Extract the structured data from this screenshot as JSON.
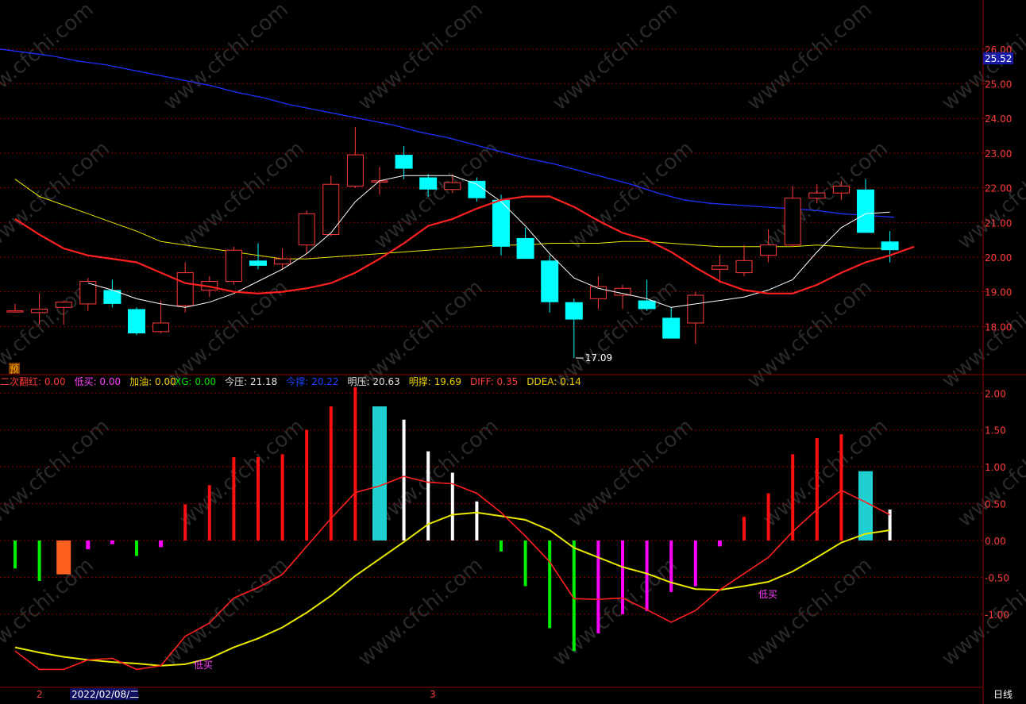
{
  "colors": {
    "background": "#000000",
    "grid": "#8B0000",
    "up": "#FF3A3A",
    "down": "#00FFFF",
    "axis_text": "#FF3A3A",
    "ma_white": "#FFFFFF",
    "ma_yellow": "#E8E800",
    "ma_red": "#FF2020",
    "ma_blue": "#2030FF",
    "macd_pos": "#FF1010",
    "macd_neg": "#00EE00",
    "magenta": "#FF00FF",
    "cyan_bar": "#20D0D0",
    "orange_bar": "#FF6020",
    "white_bar": "#FFFFFF"
  },
  "ui": {
    "price_tag": "25.52",
    "low_annotation": "17.09",
    "yu_badge": "预",
    "date_label": "2022/02/08/二",
    "marker_2": "2",
    "marker_3": "3",
    "period": "日线",
    "buy_label_1": "低买",
    "buy_label_2": "低买"
  },
  "indicator_legend": [
    {
      "label": "二次翻红:",
      "value": "0.00",
      "color": "#FF3A3A"
    },
    {
      "label": "低买:",
      "value": "0.00",
      "color": "#FF40FF"
    },
    {
      "label": "加油:",
      "value": "0.00",
      "color": "#F0D000"
    },
    {
      "label": "XG:",
      "value": "0.00",
      "color": "#00E000"
    },
    {
      "label": "今压:",
      "value": "21.18",
      "color": "#E0E0E0"
    },
    {
      "label": "今撑:",
      "value": "20.22",
      "color": "#2040FF"
    },
    {
      "label": "明压:",
      "value": "20.63",
      "color": "#E0E0E0"
    },
    {
      "label": "明撑:",
      "value": "19.69",
      "color": "#F0D000"
    },
    {
      "label": "DIFF:",
      "value": "0.35",
      "color": "#FF3A3A"
    },
    {
      "label": "DDEA:",
      "value": "0.14",
      "color": "#F0D000"
    }
  ],
  "chart_data": [
    {
      "type": "candlestick",
      "ylim": [
        17.0,
        26.5
      ],
      "yticks": [
        "18.00",
        "19.00",
        "20.00",
        "21.00",
        "22.00",
        "23.00",
        "24.00",
        "25.00",
        "26.00"
      ],
      "candles": [
        {
          "o": 18.45,
          "h": 18.65,
          "l": 18.4,
          "c": 18.45
        },
        {
          "o": 18.4,
          "h": 18.95,
          "l": 18.05,
          "c": 18.5
        },
        {
          "o": 18.55,
          "h": 18.75,
          "l": 18.05,
          "c": 18.7
        },
        {
          "o": 18.65,
          "h": 19.4,
          "l": 18.45,
          "c": 19.3
        },
        {
          "o": 19.05,
          "h": 19.35,
          "l": 18.55,
          "c": 18.65
        },
        {
          "o": 18.5,
          "h": 18.55,
          "l": 17.75,
          "c": 17.8
        },
        {
          "o": 17.85,
          "h": 18.75,
          "l": 17.8,
          "c": 18.1
        },
        {
          "o": 18.6,
          "h": 19.85,
          "l": 18.4,
          "c": 19.55
        },
        {
          "o": 19.05,
          "h": 19.45,
          "l": 18.85,
          "c": 19.3
        },
        {
          "o": 19.3,
          "h": 20.3,
          "l": 19.2,
          "c": 20.2
        },
        {
          "o": 19.9,
          "h": 20.4,
          "l": 19.65,
          "c": 19.75
        },
        {
          "o": 19.8,
          "h": 20.25,
          "l": 19.65,
          "c": 19.95
        },
        {
          "o": 20.35,
          "h": 21.35,
          "l": 20.1,
          "c": 21.25
        },
        {
          "o": 20.65,
          "h": 22.35,
          "l": 20.6,
          "c": 22.1
        },
        {
          "o": 22.05,
          "h": 23.75,
          "l": 22.0,
          "c": 22.95
        },
        {
          "o": 22.2,
          "h": 22.6,
          "l": 21.8,
          "c": 22.2
        },
        {
          "o": 22.95,
          "h": 23.2,
          "l": 22.25,
          "c": 22.55
        },
        {
          "o": 22.3,
          "h": 22.4,
          "l": 21.75,
          "c": 21.95
        },
        {
          "o": 21.95,
          "h": 22.4,
          "l": 21.85,
          "c": 22.15
        },
        {
          "o": 22.2,
          "h": 22.3,
          "l": 21.6,
          "c": 21.7
        },
        {
          "o": 21.65,
          "h": 21.8,
          "l": 20.05,
          "c": 20.3
        },
        {
          "o": 20.55,
          "h": 20.85,
          "l": 20.0,
          "c": 19.95
        },
        {
          "o": 19.9,
          "h": 20.05,
          "l": 18.4,
          "c": 18.7
        },
        {
          "o": 18.7,
          "h": 18.8,
          "l": 17.09,
          "c": 18.2
        },
        {
          "o": 18.8,
          "h": 19.45,
          "l": 18.5,
          "c": 19.15
        },
        {
          "o": 18.9,
          "h": 19.2,
          "l": 18.5,
          "c": 19.1
        },
        {
          "o": 18.75,
          "h": 19.35,
          "l": 18.45,
          "c": 18.5
        },
        {
          "o": 18.25,
          "h": 18.55,
          "l": 17.65,
          "c": 17.65
        },
        {
          "o": 18.1,
          "h": 19.0,
          "l": 17.5,
          "c": 18.9
        },
        {
          "o": 19.65,
          "h": 20.05,
          "l": 19.25,
          "c": 19.75
        },
        {
          "o": 19.55,
          "h": 20.35,
          "l": 19.45,
          "c": 19.9
        },
        {
          "o": 20.05,
          "h": 20.8,
          "l": 19.85,
          "c": 20.35
        },
        {
          "o": 20.35,
          "h": 22.05,
          "l": 20.3,
          "c": 21.7
        },
        {
          "o": 21.7,
          "h": 22.1,
          "l": 21.55,
          "c": 21.85
        },
        {
          "o": 21.85,
          "h": 22.2,
          "l": 21.65,
          "c": 22.05
        },
        {
          "o": 21.95,
          "h": 22.25,
          "l": 20.75,
          "c": 20.7
        },
        {
          "o": 20.45,
          "h": 20.75,
          "l": 19.85,
          "c": 20.2
        }
      ],
      "ma_white": [
        null,
        null,
        null,
        19.25,
        19.05,
        18.8,
        18.65,
        18.55,
        18.7,
        18.95,
        19.3,
        19.65,
        20.1,
        20.7,
        21.6,
        22.2,
        22.35,
        22.35,
        22.35,
        22.1,
        21.6,
        20.9,
        20.1,
        19.4,
        19.1,
        18.95,
        18.8,
        18.55,
        18.65,
        18.75,
        18.85,
        19.05,
        19.35,
        20.15,
        20.85,
        21.25,
        21.3
      ],
      "ma_yellow": [
        22.25,
        21.75,
        21.5,
        21.25,
        21.0,
        20.75,
        20.45,
        20.35,
        20.25,
        20.15,
        20.05,
        19.95,
        19.95,
        20.0,
        20.05,
        20.1,
        20.15,
        20.2,
        20.25,
        20.3,
        20.35,
        20.35,
        20.4,
        20.4,
        20.4,
        20.45,
        20.45,
        20.4,
        20.35,
        20.3,
        20.3,
        20.3,
        20.3,
        20.35,
        20.3,
        20.25,
        20.25
      ],
      "ma_red": [
        21.1,
        20.65,
        20.25,
        20.05,
        19.95,
        19.85,
        19.55,
        19.25,
        19.15,
        19.0,
        18.95,
        19.0,
        19.1,
        19.25,
        19.55,
        19.95,
        20.4,
        20.9,
        21.1,
        21.4,
        21.65,
        21.75,
        21.75,
        21.45,
        21.05,
        20.7,
        20.5,
        20.15,
        19.7,
        19.3,
        19.05,
        18.95,
        18.95,
        19.2,
        19.55,
        19.85,
        20.05,
        20.3
      ],
      "ma_blue": [
        26.0,
        25.9,
        25.8,
        25.65,
        25.55,
        25.4,
        25.25,
        25.1,
        24.95,
        24.75,
        24.6,
        24.4,
        24.25,
        24.1,
        23.95,
        23.8,
        23.6,
        23.45,
        23.25,
        23.05,
        22.85,
        22.7,
        22.5,
        22.3,
        22.1,
        21.85,
        21.65,
        21.55,
        21.5,
        21.45,
        21.4,
        21.35,
        21.25,
        21.2,
        21.15
      ],
      "annotations": [
        {
          "index": 23,
          "value": 17.09,
          "text": "17.09"
        }
      ],
      "last_price": 25.52
    },
    {
      "type": "bar+line",
      "ylim": [
        -1.95,
        2.1
      ],
      "yticks": [
        "2.00",
        "1.50",
        "1.00",
        "0.50",
        "0.00",
        "-0.50",
        "-1.00"
      ],
      "bars": [
        {
          "v": -0.38,
          "t": "g"
        },
        {
          "v": -0.55,
          "t": "g"
        },
        {
          "v": -0.46,
          "t": "o"
        },
        {
          "v": -0.12,
          "t": "m"
        },
        {
          "v": -0.05,
          "t": "m"
        },
        {
          "v": -0.21,
          "t": "g"
        },
        {
          "v": -0.09,
          "t": "m"
        },
        {
          "v": 0.49,
          "t": "r"
        },
        {
          "v": 0.75,
          "t": "r"
        },
        {
          "v": 1.13,
          "t": "r"
        },
        {
          "v": 1.13,
          "t": "r"
        },
        {
          "v": 1.17,
          "t": "r"
        },
        {
          "v": 1.5,
          "t": "r"
        },
        {
          "v": 1.82,
          "t": "r"
        },
        {
          "v": 2.08,
          "t": "r"
        },
        {
          "v": 1.82,
          "t": "c"
        },
        {
          "v": 1.64,
          "t": "w"
        },
        {
          "v": 1.21,
          "t": "w"
        },
        {
          "v": 0.92,
          "t": "w"
        },
        {
          "v": 0.53,
          "t": "w"
        },
        {
          "v": -0.15,
          "t": "g"
        },
        {
          "v": -0.62,
          "t": "g"
        },
        {
          "v": -1.19,
          "t": "g"
        },
        {
          "v": -1.5,
          "t": "g"
        },
        {
          "v": -1.26,
          "t": "m"
        },
        {
          "v": -1.0,
          "t": "m"
        },
        {
          "v": -0.96,
          "t": "m"
        },
        {
          "v": -0.7,
          "t": "m"
        },
        {
          "v": -0.62,
          "t": "m"
        },
        {
          "v": -0.08,
          "t": "m"
        },
        {
          "v": 0.32,
          "t": "r"
        },
        {
          "v": 0.64,
          "t": "r"
        },
        {
          "v": 1.17,
          "t": "r"
        },
        {
          "v": 1.39,
          "t": "r"
        },
        {
          "v": 1.44,
          "t": "r"
        },
        {
          "v": 0.94,
          "t": "c"
        },
        {
          "v": 0.42,
          "t": "w"
        }
      ],
      "diff": [
        -1.5,
        -1.75,
        -1.75,
        -1.62,
        -1.6,
        -1.75,
        -1.7,
        -1.3,
        -1.12,
        -0.78,
        -0.64,
        -0.46,
        -0.08,
        0.3,
        0.65,
        0.74,
        0.87,
        0.79,
        0.77,
        0.64,
        0.38,
        0.06,
        -0.29,
        -0.79,
        -0.8,
        -0.78,
        -0.94,
        -1.11,
        -0.95,
        -0.67,
        -0.45,
        -0.23,
        0.12,
        0.42,
        0.68,
        0.52,
        0.35
      ],
      "ddea": [
        -1.45,
        -1.52,
        -1.58,
        -1.62,
        -1.65,
        -1.67,
        -1.7,
        -1.68,
        -1.6,
        -1.45,
        -1.33,
        -1.18,
        -0.98,
        -0.75,
        -0.48,
        -0.25,
        -0.02,
        0.22,
        0.35,
        0.38,
        0.33,
        0.28,
        0.14,
        -0.1,
        -0.23,
        -0.36,
        -0.45,
        -0.57,
        -0.66,
        -0.67,
        -0.62,
        -0.56,
        -0.42,
        -0.23,
        -0.03,
        0.09,
        0.14
      ]
    }
  ]
}
